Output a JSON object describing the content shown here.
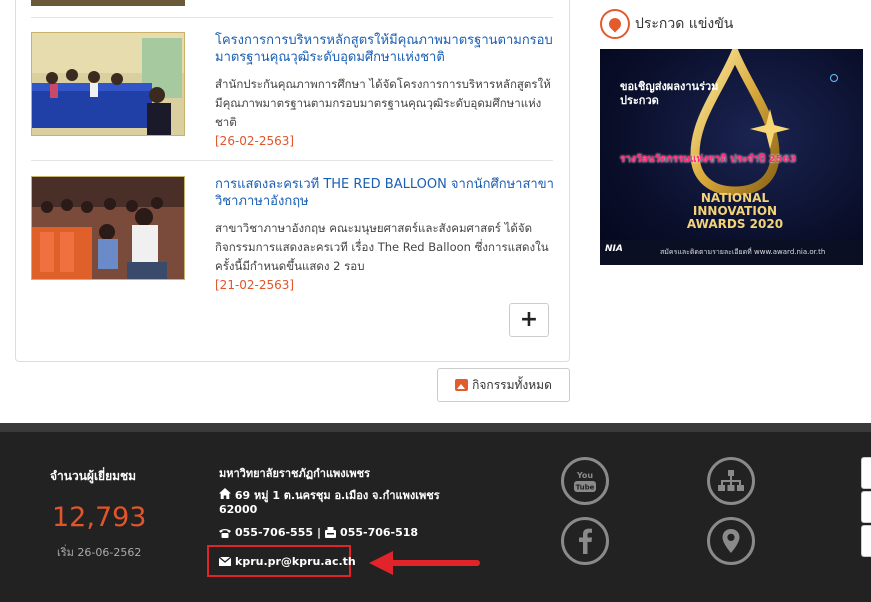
{
  "news": {
    "items": [
      {
        "title": "โครงการการบริหารหลักสูตรให้มีคุณภาพมาตรฐานตามกรอบมาตรฐานคุณวุฒิระดับอุดมศึกษาแห่งชาติ",
        "description": "สำนักประกันคุณภาพการศึกษา ได้จัดโครงการการบริหารหลักสูตรให้มีคุณภาพมาตรฐานตามกรอบมาตรฐานคุณวุฒิระดับอุดมศึกษาแห่งชาติ",
        "date": "[26-02-2563]"
      },
      {
        "title": "การแสดงละครเวที THE RED BALLOON จากนักศึกษาสาขาวิชาภาษาอังกฤษ",
        "description": "สาขาวิชาภาษาอังกฤษ คณะมนุษยศาสตร์และสังคมศาสตร์ ได้จัดกิจกรรมการแสดงละครเวที เรื่อง The Red Balloon ซึ่งการแสดงในครั้งนี้มีกำหนดขึ้นแสดง 2 รอบ",
        "date": "[21-02-2563]"
      }
    ],
    "more_label": "+",
    "all_activities_label": "กิจกรรมทั้งหมด"
  },
  "contest": {
    "title": "ประกวด แข่งขัน",
    "banner": {
      "invite": "ขอเชิญส่งผลงานร่วมประกวด",
      "award": "รางวัลนวัตกรรมแห่งชาติ ประจำปี 2563",
      "title": "NATIONAL INNOVATION AWARDS 2020",
      "logo": "NIA",
      "footer": "สมัครและติดตามรายละเอียดที่ www.award.nia.or.th"
    }
  },
  "footer": {
    "visitors_label": "จำนวนผู้เยี่ยมชม",
    "visitors_count": "12,793",
    "visitors_since": "เริ่ม 26-06-2562",
    "university": "มหาวิทยาลัยราชภัฏกำแพงเพชร",
    "address": "69 หมู่ 1 ต.นครชุม อ.เมือง จ.กำแพงเพชร 62000",
    "phone": "055-706-555",
    "fax": "055-706-518",
    "phone_separator": "|",
    "email": "kpru.pr@kpru.ac.th",
    "social": [
      "youtube-icon",
      "sitemap-icon",
      "facebook-icon",
      "location-pin-icon"
    ]
  },
  "colors": {
    "accent": "#e0562a",
    "link": "#1a5fb4",
    "highlight": "#e0242a",
    "footer_bg": "#222222"
  }
}
